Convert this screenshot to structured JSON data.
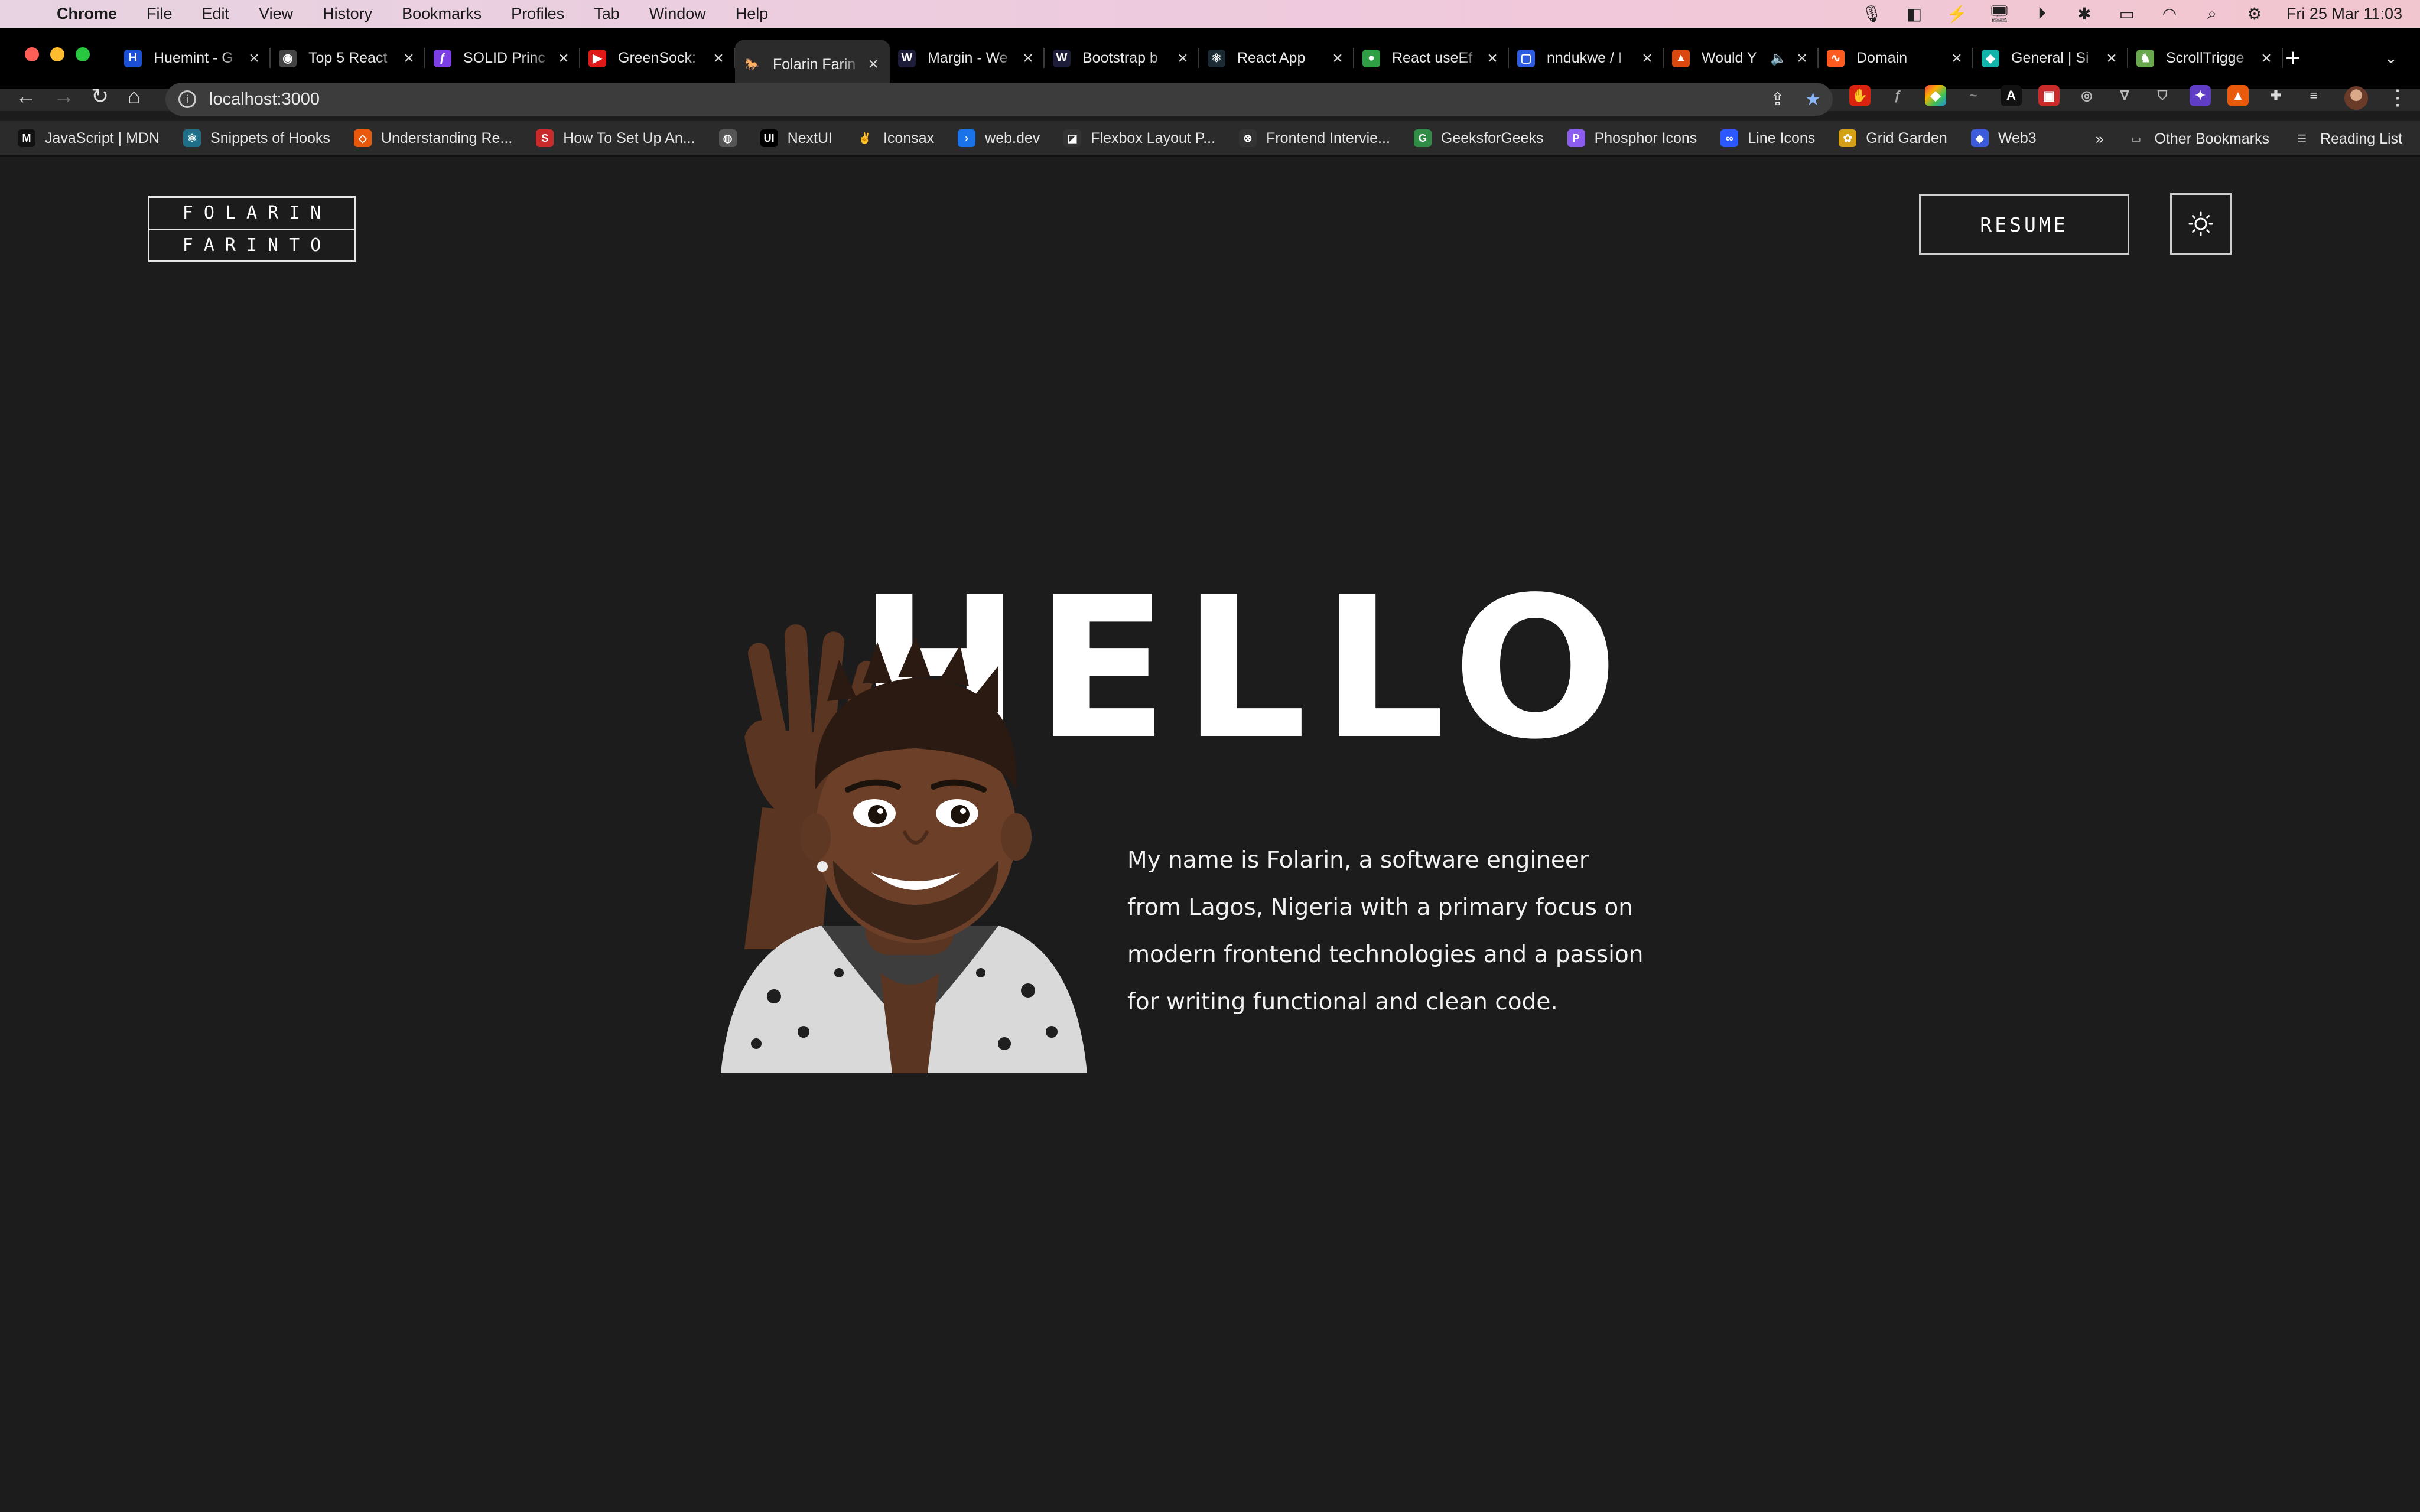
{
  "menubar": {
    "app": "Chrome",
    "items": [
      "File",
      "Edit",
      "View",
      "History",
      "Bookmarks",
      "Profiles",
      "Tab",
      "Window",
      "Help"
    ],
    "datetime": "Fri 25 Mar  11:03"
  },
  "tabs": [
    {
      "label": "Huemint - G",
      "color": "#1a4fd6",
      "glyph": "H"
    },
    {
      "label": "Top 5 React",
      "color": "#444444",
      "glyph": "◉"
    },
    {
      "label": "SOLID Princ",
      "color": "#7b3fe4",
      "glyph": "ƒ"
    },
    {
      "label": "GreenSock: ",
      "color": "#e01818",
      "glyph": "▶"
    },
    {
      "label": "Folarin Farin",
      "color": "#2b2b2b",
      "glyph": "🐎",
      "active": true
    },
    {
      "label": "Margin - We",
      "color": "#1d1d3a",
      "glyph": "W"
    },
    {
      "label": "Bootstrap b",
      "color": "#1d1d3a",
      "glyph": "W"
    },
    {
      "label": "React App",
      "color": "#1b2a33",
      "glyph": "⚛"
    },
    {
      "label": "React useEf",
      "color": "#2f9e44",
      "glyph": "●"
    },
    {
      "label": "nndukwe / I",
      "color": "#2c5be0",
      "glyph": "▢"
    },
    {
      "label": "Would Y",
      "color": "#d9480f",
      "glyph": "▲",
      "audio": "🔈"
    },
    {
      "label": "Domain",
      "color": "#ff5a1f",
      "glyph": "∿"
    },
    {
      "label": "General | Si",
      "color": "#12b3a8",
      "glyph": "◆"
    },
    {
      "label": "ScrollTrigge",
      "color": "#6aa84f",
      "glyph": "♞"
    }
  ],
  "toolbar": {
    "url": "localhost:3000"
  },
  "bookmarks": [
    {
      "label": "JavaScript | MDN",
      "color": "#111111",
      "glyph": "M"
    },
    {
      "label": "Snippets of Hooks",
      "color": "#1e6f87",
      "glyph": "⚛"
    },
    {
      "label": "Understanding Re...",
      "color": "#e8590c",
      "glyph": "◇"
    },
    {
      "label": "How To Set Up An...",
      "color": "#c92a2a",
      "glyph": "S"
    },
    {
      "label": "",
      "color": "#555555",
      "glyph": "◍"
    },
    {
      "label": "NextUI",
      "color": "#000000",
      "glyph": "UI"
    },
    {
      "label": "Iconsax",
      "color": "#2b2b2b",
      "glyph": "✌"
    },
    {
      "label": "web.dev",
      "color": "#1a73e8",
      "glyph": "›"
    },
    {
      "label": "Flexbox Layout P...",
      "color": "#333333",
      "glyph": "◪"
    },
    {
      "label": "Frontend Intervie...",
      "color": "#333333",
      "glyph": "⊗"
    },
    {
      "label": "GeeksforGeeks",
      "color": "#2f8d46",
      "glyph": "G"
    },
    {
      "label": "Phosphor Icons",
      "color": "#8c5cf0",
      "glyph": "P"
    },
    {
      "label": "Line Icons",
      "color": "#2b59ff",
      "glyph": "∞"
    },
    {
      "label": "Grid Garden",
      "color": "#d4a017",
      "glyph": "✿"
    },
    {
      "label": "Web3",
      "color": "#3b5bdb",
      "glyph": "◆"
    }
  ],
  "bookmarks_right": {
    "overflow": "»",
    "other": "Other Bookmarks",
    "reading": "Reading List"
  },
  "page": {
    "logo_line1": "FOLARIN",
    "logo_line2": "FARINTO",
    "resume_label": "RESUME",
    "hello": "HELLO",
    "bio": "My name is Folarin, a software engineer from Lagos, Nigeria with a primary focus on modern frontend technologies and a passion for writing functional and clean code."
  },
  "colors": {
    "page_bg": "#1c1c1c",
    "text": "#ffffff",
    "tab_bg": "#000000",
    "active_tab": "#2b2b2b"
  }
}
